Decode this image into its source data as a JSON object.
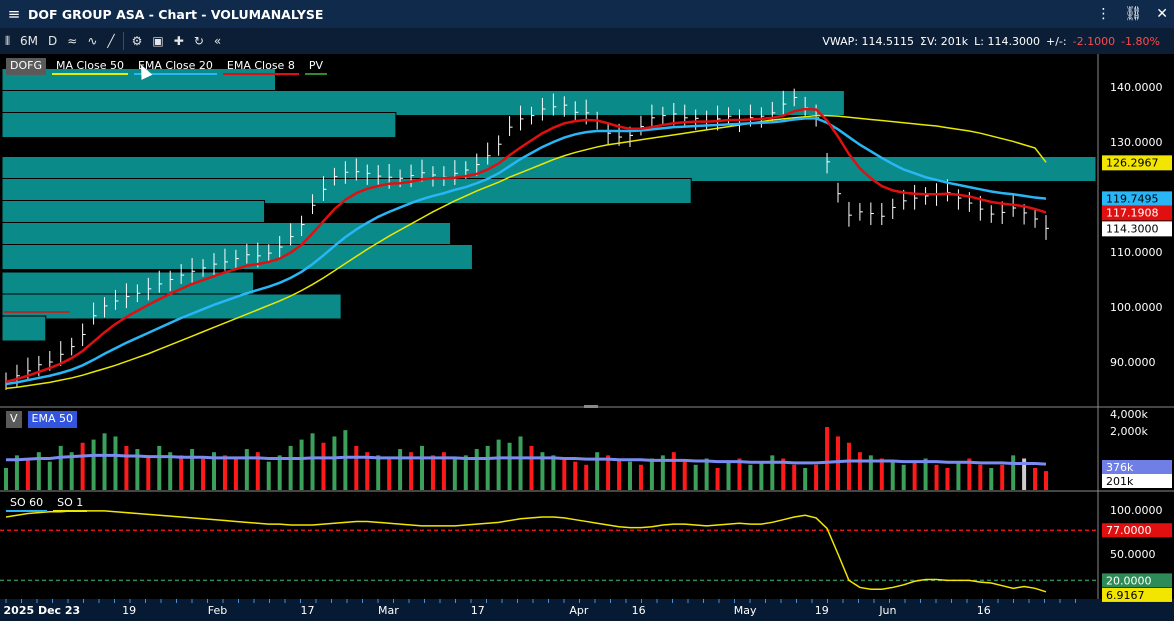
{
  "window": {
    "title": "DOF GROUP ASA - Chart - VOLUMANALYSE"
  },
  "toolbar": {
    "period": "6M",
    "interval": "D",
    "collapse_label": "«"
  },
  "stats": {
    "vwap": "VWAP: 114.5115",
    "sum_volume": "ΣV: 201k",
    "last": "L: 114.3000",
    "change_label": "+/-:",
    "change": "-2.1000",
    "change_pct": "-1.80%"
  },
  "price_panel": {
    "legend": [
      {
        "label": "DOFG",
        "color": "#5a5a5a",
        "kind": "sym"
      },
      {
        "label": "MA  Close 50",
        "color": "#e8e800"
      },
      {
        "label": "EMA  Close 20",
        "color": "#29b6f6"
      },
      {
        "label": "EMA  Close 8",
        "color": "#e01010"
      },
      {
        "label": "PV",
        "color": "#2e8b2e"
      }
    ],
    "axis_labels": [
      "140.0000",
      "130.0000",
      "120.0000",
      "110.0000",
      "100.0000",
      "90.0000"
    ],
    "axis_values": [
      140,
      130,
      120,
      110,
      100,
      90
    ],
    "markers": [
      {
        "value": "126.2967",
        "bg": "#f2e600",
        "fg": "#000",
        "price": 126.3
      },
      {
        "value": "119.7495",
        "bg": "#29b6f6",
        "fg": "#000",
        "price": 119.75
      },
      {
        "value": "117.1908",
        "bg": "#e01010",
        "fg": "#fff",
        "price": 117.19
      },
      {
        "value": "114.3000",
        "bg": "#ffffff",
        "fg": "#000",
        "price": 114.3
      }
    ]
  },
  "volume_panel": {
    "legend": [
      {
        "label": "V",
        "color": "#5a5a5a",
        "kind": "sym"
      },
      {
        "label": "EMA  50",
        "color": "#3355dd"
      }
    ],
    "axis_labels": [
      "4,000k",
      "2,000k"
    ],
    "markers": [
      {
        "value": "376k",
        "bg": "#6f7fe6",
        "fg": "#fff"
      },
      {
        "value": "201k",
        "bg": "#ffffff",
        "fg": "#000"
      }
    ]
  },
  "so_panel": {
    "legend": [
      {
        "label": "SO  60",
        "color": "#29b6f6"
      },
      {
        "label": "SO  1",
        "color": "#e8e800"
      }
    ],
    "axis_labels": [
      "100.0000",
      "50.0000"
    ],
    "markers": [
      {
        "value": "77.0000",
        "bg": "#e01010",
        "fg": "#fff"
      },
      {
        "value": "20.0000",
        "bg": "#2e8b57",
        "fg": "#fff"
      },
      {
        "value": "6.9167",
        "bg": "#f2e600",
        "fg": "#000"
      }
    ]
  },
  "date_axis": [
    {
      "label": "2025 Dec 23",
      "x": 0.003
    },
    {
      "label": "19",
      "x": 0.104
    },
    {
      "label": "Feb",
      "x": 0.177
    },
    {
      "label": "17",
      "x": 0.256
    },
    {
      "label": "Mar",
      "x": 0.322
    },
    {
      "label": "17",
      "x": 0.401
    },
    {
      "label": "Apr",
      "x": 0.485
    },
    {
      "label": "16",
      "x": 0.538
    },
    {
      "label": "May",
      "x": 0.625
    },
    {
      "label": "19",
      "x": 0.694
    },
    {
      "label": "Jun",
      "x": 0.749
    },
    {
      "label": "16",
      "x": 0.832
    }
  ],
  "chart_data": {
    "type": "line",
    "ylim": [
      82,
      146
    ],
    "volume_profile": [
      {
        "price": 141,
        "width": 0.25
      },
      {
        "price": 137,
        "width": 0.77
      },
      {
        "price": 133,
        "width": 0.36
      },
      {
        "price": 125,
        "width": 1.0
      },
      {
        "price": 121,
        "width": 0.63
      },
      {
        "price": 117,
        "width": 0.24
      },
      {
        "price": 113,
        "width": 0.41
      },
      {
        "price": 109,
        "width": 0.43
      },
      {
        "price": 104,
        "width": 0.23
      },
      {
        "price": 100,
        "width": 0.31
      },
      {
        "price": 96,
        "width": 0.04
      }
    ],
    "price_series": [
      86.5,
      87.5,
      88.4,
      89.5,
      90.0,
      91.4,
      92.8,
      95.0,
      98.4,
      100.2,
      101.1,
      101.9,
      102.5,
      103.3,
      104.2,
      105.0,
      105.8,
      106.5,
      107.1,
      107.8,
      108.2,
      108.8,
      109.5,
      109.3,
      109.8,
      110.9,
      112.8,
      115.0,
      118.5,
      121.4,
      123.7,
      124.5,
      124.6,
      124.3,
      123.8,
      123.6,
      123.4,
      123.9,
      124.4,
      124.0,
      123.6,
      124.3,
      124.9,
      125.9,
      127.5,
      129.6,
      132.7,
      134.2,
      134.8,
      136.0,
      136.4,
      136.7,
      135.4,
      135.3,
      133.9,
      131.6,
      130.9,
      131.2,
      132.8,
      134.4,
      134.8,
      135.1,
      134.4,
      134.3,
      133.7,
      134.2,
      134.7,
      133.9,
      134.4,
      134.7,
      135.3,
      136.9,
      138.1,
      136.2,
      134.4,
      126.4,
      120.6,
      116.7,
      117.3,
      117.0,
      116.5,
      118.1,
      119.3,
      119.8,
      120.2,
      120.5,
      120.8,
      119.8,
      118.9,
      117.8,
      116.9,
      117.2,
      118.0,
      117.1,
      116.0,
      114.3
    ],
    "series": [
      {
        "name": "MA  Close 50",
        "color": "#e8e800",
        "values": [
          85.2,
          85.4,
          85.7,
          86.0,
          86.3,
          86.7,
          87.1,
          87.6,
          88.2,
          88.8,
          89.4,
          90.1,
          90.8,
          91.5,
          92.3,
          93.1,
          93.9,
          94.7,
          95.5,
          96.3,
          97.1,
          97.9,
          98.7,
          99.5,
          100.3,
          101.1,
          102.0,
          103.0,
          104.1,
          105.3,
          106.6,
          107.9,
          109.2,
          110.5,
          111.7,
          112.9,
          114.0,
          115.1,
          116.2,
          117.3,
          118.3,
          119.3,
          120.2,
          121.1,
          121.9,
          122.7,
          123.6,
          124.4,
          125.2,
          126.0,
          126.8,
          127.5,
          128.1,
          128.6,
          129.1,
          129.5,
          129.8,
          130.1,
          130.4,
          130.7,
          131.0,
          131.3,
          131.6,
          131.9,
          132.2,
          132.5,
          132.8,
          133.1,
          133.4,
          133.7,
          134.0,
          134.2,
          134.4,
          134.6,
          134.8,
          134.8,
          134.7,
          134.5,
          134.3,
          134.1,
          133.9,
          133.7,
          133.5,
          133.3,
          133.1,
          132.9,
          132.6,
          132.3,
          132.0,
          131.6,
          131.1,
          130.6,
          130.1,
          129.5,
          128.9,
          126.3
        ]
      },
      {
        "name": "EMA  Close 20",
        "color": "#29b6f6",
        "values": [
          86.0,
          86.3,
          86.7,
          87.1,
          87.5,
          88.0,
          88.6,
          89.4,
          90.4,
          91.5,
          92.5,
          93.5,
          94.4,
          95.3,
          96.2,
          97.1,
          98.0,
          98.8,
          99.6,
          100.4,
          101.1,
          101.8,
          102.5,
          103.1,
          103.7,
          104.4,
          105.3,
          106.4,
          107.8,
          109.4,
          111.1,
          112.7,
          114.1,
          115.3,
          116.4,
          117.3,
          118.1,
          118.9,
          119.6,
          120.2,
          120.7,
          121.3,
          121.8,
          122.5,
          123.3,
          124.3,
          125.6,
          126.9,
          128.0,
          129.1,
          130.0,
          130.8,
          131.4,
          131.8,
          132.0,
          132.0,
          132.0,
          132.0,
          132.1,
          132.3,
          132.5,
          132.7,
          132.8,
          132.9,
          133.0,
          133.1,
          133.2,
          133.3,
          133.4,
          133.5,
          133.6,
          133.8,
          134.1,
          134.3,
          134.3,
          133.5,
          132.3,
          130.9,
          129.5,
          128.3,
          127.1,
          126.0,
          125.0,
          124.3,
          123.6,
          123.1,
          122.6,
          122.2,
          121.8,
          121.4,
          121.0,
          120.7,
          120.5,
          120.2,
          119.9,
          119.7
        ]
      },
      {
        "name": "EMA  Close 8",
        "color": "#e01010",
        "values": [
          86.4,
          86.9,
          87.5,
          88.2,
          88.9,
          89.7,
          90.7,
          92.0,
          93.7,
          95.4,
          96.9,
          98.2,
          99.3,
          100.4,
          101.4,
          102.4,
          103.3,
          104.2,
          104.9,
          105.6,
          106.3,
          106.9,
          107.5,
          107.8,
          108.2,
          108.8,
          109.9,
          111.3,
          113.4,
          115.6,
          117.8,
          119.5,
          120.7,
          121.5,
          122.0,
          122.4,
          122.5,
          122.8,
          123.2,
          123.4,
          123.4,
          123.5,
          123.8,
          124.2,
          125.0,
          126.1,
          127.6,
          129.0,
          130.3,
          131.6,
          132.6,
          133.4,
          133.8,
          134.0,
          133.9,
          133.4,
          132.8,
          132.4,
          132.4,
          132.7,
          133.1,
          133.4,
          133.6,
          133.7,
          133.7,
          133.8,
          134.0,
          134.0,
          134.1,
          134.2,
          134.4,
          134.8,
          135.6,
          136.0,
          135.9,
          133.9,
          131.0,
          127.8,
          125.2,
          123.4,
          122.0,
          121.2,
          120.8,
          120.6,
          120.5,
          120.5,
          120.6,
          120.4,
          120.1,
          119.6,
          119.1,
          118.8,
          118.6,
          118.3,
          117.8,
          117.2
        ]
      }
    ],
    "volume": {
      "values": [
        0.35,
        0.55,
        0.5,
        0.6,
        0.45,
        0.7,
        0.6,
        0.75,
        0.8,
        0.9,
        0.85,
        0.7,
        0.65,
        0.55,
        0.7,
        0.6,
        0.55,
        0.65,
        0.5,
        0.6,
        0.55,
        0.5,
        0.65,
        0.6,
        0.45,
        0.55,
        0.7,
        0.8,
        0.9,
        0.75,
        0.85,
        0.95,
        0.7,
        0.6,
        0.55,
        0.5,
        0.65,
        0.6,
        0.7,
        0.55,
        0.6,
        0.5,
        0.55,
        0.65,
        0.7,
        0.8,
        0.75,
        0.85,
        0.7,
        0.6,
        0.55,
        0.5,
        0.45,
        0.4,
        0.6,
        0.55,
        0.5,
        0.45,
        0.4,
        0.5,
        0.55,
        0.6,
        0.45,
        0.4,
        0.5,
        0.35,
        0.45,
        0.5,
        0.4,
        0.45,
        0.55,
        0.5,
        0.4,
        0.35,
        0.4,
        1.0,
        0.85,
        0.75,
        0.6,
        0.55,
        0.5,
        0.45,
        0.4,
        0.45,
        0.5,
        0.4,
        0.35,
        0.45,
        0.5,
        0.4,
        0.35,
        0.4,
        0.55,
        0.5,
        0.35,
        0.3
      ],
      "colors": [
        "g",
        "g",
        "r",
        "g",
        "g",
        "g",
        "g",
        "r",
        "g",
        "g",
        "g",
        "r",
        "g",
        "r",
        "g",
        "g",
        "r",
        "g",
        "r",
        "g",
        "r",
        "r",
        "g",
        "r",
        "g",
        "g",
        "g",
        "g",
        "g",
        "r",
        "g",
        "g",
        "r",
        "r",
        "g",
        "r",
        "g",
        "r",
        "g",
        "r",
        "r",
        "g",
        "g",
        "g",
        "g",
        "g",
        "g",
        "g",
        "r",
        "g",
        "g",
        "r",
        "r",
        "r",
        "g",
        "r",
        "r",
        "g",
        "r",
        "g",
        "g",
        "r",
        "r",
        "g",
        "g",
        "r",
        "g",
        "r",
        "g",
        "g",
        "g",
        "r",
        "r",
        "g",
        "r",
        "r",
        "r",
        "r",
        "r",
        "g",
        "r",
        "g",
        "g",
        "r",
        "g",
        "r",
        "r",
        "g",
        "r",
        "r",
        "g",
        "r",
        "g",
        "w",
        "r",
        "r"
      ],
      "ema": [
        0.48,
        0.48,
        0.49,
        0.5,
        0.5,
        0.52,
        0.53,
        0.54,
        0.55,
        0.55,
        0.55,
        0.54,
        0.54,
        0.53,
        0.53,
        0.53,
        0.52,
        0.52,
        0.52,
        0.51,
        0.51,
        0.51,
        0.51,
        0.51,
        0.5,
        0.5,
        0.5,
        0.5,
        0.51,
        0.51,
        0.51,
        0.52,
        0.52,
        0.52,
        0.51,
        0.51,
        0.51,
        0.51,
        0.51,
        0.51,
        0.51,
        0.51,
        0.5,
        0.5,
        0.5,
        0.51,
        0.51,
        0.51,
        0.51,
        0.51,
        0.51,
        0.5,
        0.5,
        0.49,
        0.49,
        0.49,
        0.48,
        0.48,
        0.48,
        0.47,
        0.47,
        0.47,
        0.47,
        0.46,
        0.46,
        0.45,
        0.45,
        0.45,
        0.44,
        0.44,
        0.44,
        0.44,
        0.43,
        0.43,
        0.43,
        0.44,
        0.45,
        0.46,
        0.46,
        0.46,
        0.46,
        0.46,
        0.45,
        0.45,
        0.45,
        0.45,
        0.44,
        0.44,
        0.44,
        0.43,
        0.43,
        0.43,
        0.42,
        0.42,
        0.42,
        0.41
      ]
    },
    "stochastic": {
      "values": [
        92,
        94,
        96,
        97,
        98,
        98,
        99,
        99,
        99,
        99,
        98,
        97,
        96,
        95,
        94,
        93,
        92,
        91,
        90,
        89,
        88,
        87,
        86,
        85,
        84,
        84,
        83,
        83,
        83,
        84,
        85,
        86,
        87,
        87,
        86,
        85,
        84,
        83,
        82,
        82,
        82,
        82,
        83,
        84,
        85,
        86,
        88,
        90,
        91,
        92,
        92,
        91,
        89,
        87,
        85,
        83,
        81,
        80,
        80,
        81,
        83,
        84,
        84,
        83,
        82,
        83,
        84,
        85,
        84,
        84,
        86,
        89,
        92,
        94,
        91,
        79,
        50,
        20,
        12,
        10,
        10,
        12,
        15,
        19,
        21,
        21,
        20,
        20,
        20,
        18,
        17,
        14,
        11,
        13,
        11,
        7
      ]
    }
  }
}
